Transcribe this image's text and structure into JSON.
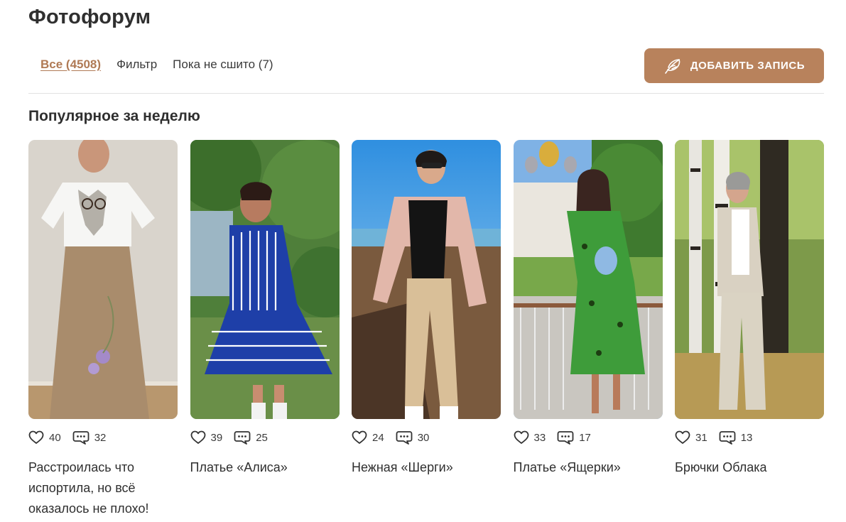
{
  "page": {
    "title": "Фотофорум"
  },
  "filters": [
    {
      "label": "Все (4508)",
      "active": true
    },
    {
      "label": "Фильтр",
      "active": false
    },
    {
      "label": "Пока не сшито (7)",
      "active": false
    }
  ],
  "add_button": {
    "label": "ДОБАВИТЬ ЗАПИСЬ",
    "icon": "feather-icon"
  },
  "section": {
    "title": "Популярное за неделю"
  },
  "colors": {
    "accent": "#b8825c",
    "link_active": "#b07a55",
    "text": "#2f2f2f"
  },
  "cards": [
    {
      "likes": "40",
      "comments": "32",
      "title": "Расстроилась что испортила, но всё оказалось не плохо!"
    },
    {
      "likes": "39",
      "comments": "25",
      "title": "Платье «Алиса»"
    },
    {
      "likes": "24",
      "comments": "30",
      "title": "Нежная «Шерги»"
    },
    {
      "likes": "33",
      "comments": "17",
      "title": "Платье «Ящерки»"
    },
    {
      "likes": "31",
      "comments": "13",
      "title": "Брючки Облака"
    }
  ]
}
